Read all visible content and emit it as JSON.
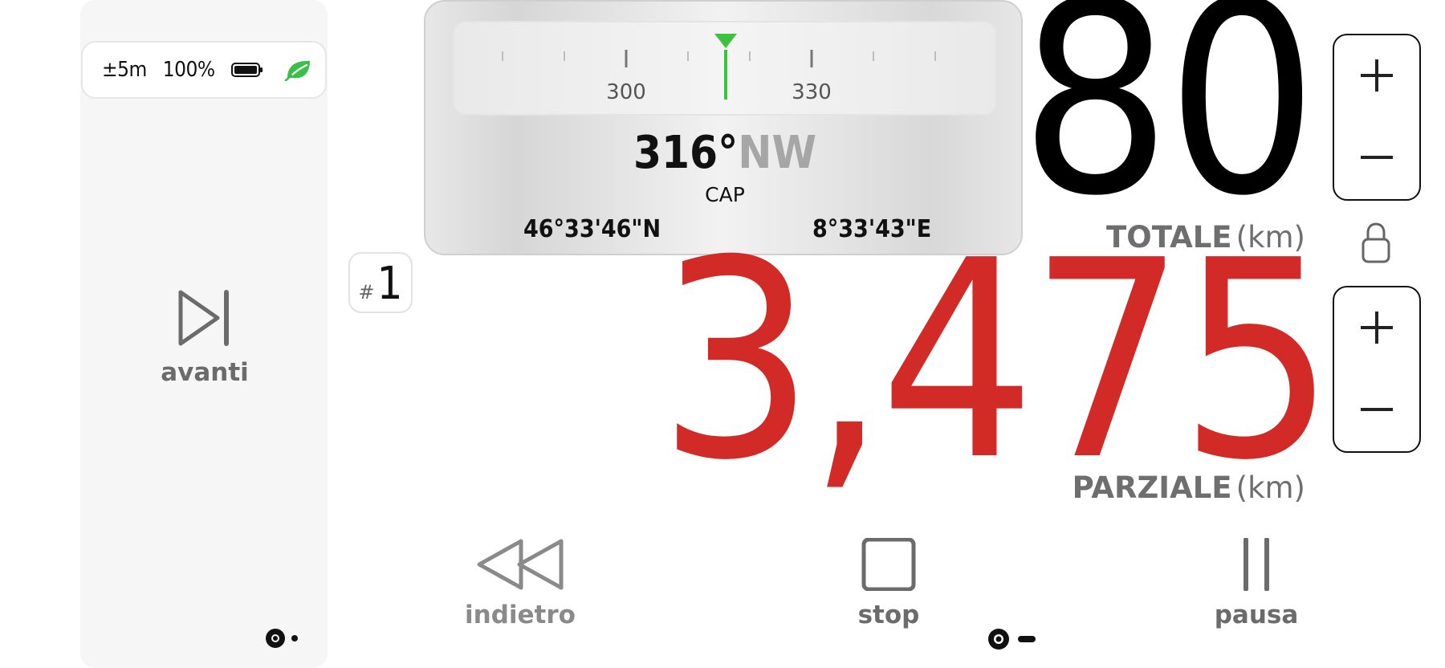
{
  "status": {
    "accuracy": "±5m",
    "battery": "100%",
    "battery_icon": "battery-full-icon",
    "eco_icon": "leaf-icon",
    "eco_color": "#3bbf4a"
  },
  "left_panel": {
    "forward_label": "avanti",
    "forward_icon": "skip-forward-icon"
  },
  "compass": {
    "tick_labels": [
      "300",
      "330"
    ],
    "heading_degrees": "316°",
    "heading_direction": "NW",
    "caption": "CAP",
    "latitude": "46°33'46\"N",
    "longitude": "8°33'43\"E",
    "needle_color": "#3cc23c"
  },
  "trip": {
    "hash": "#",
    "number": "1"
  },
  "total": {
    "value": "80",
    "label": "TOTALE",
    "unit": "(km)"
  },
  "partial": {
    "value": "3,475",
    "label": "PARZIALE",
    "unit": "(km)",
    "color": "#d22b27"
  },
  "controls": {
    "back_label": "indietro",
    "stop_label": "stop",
    "pause_label": "pausa"
  }
}
